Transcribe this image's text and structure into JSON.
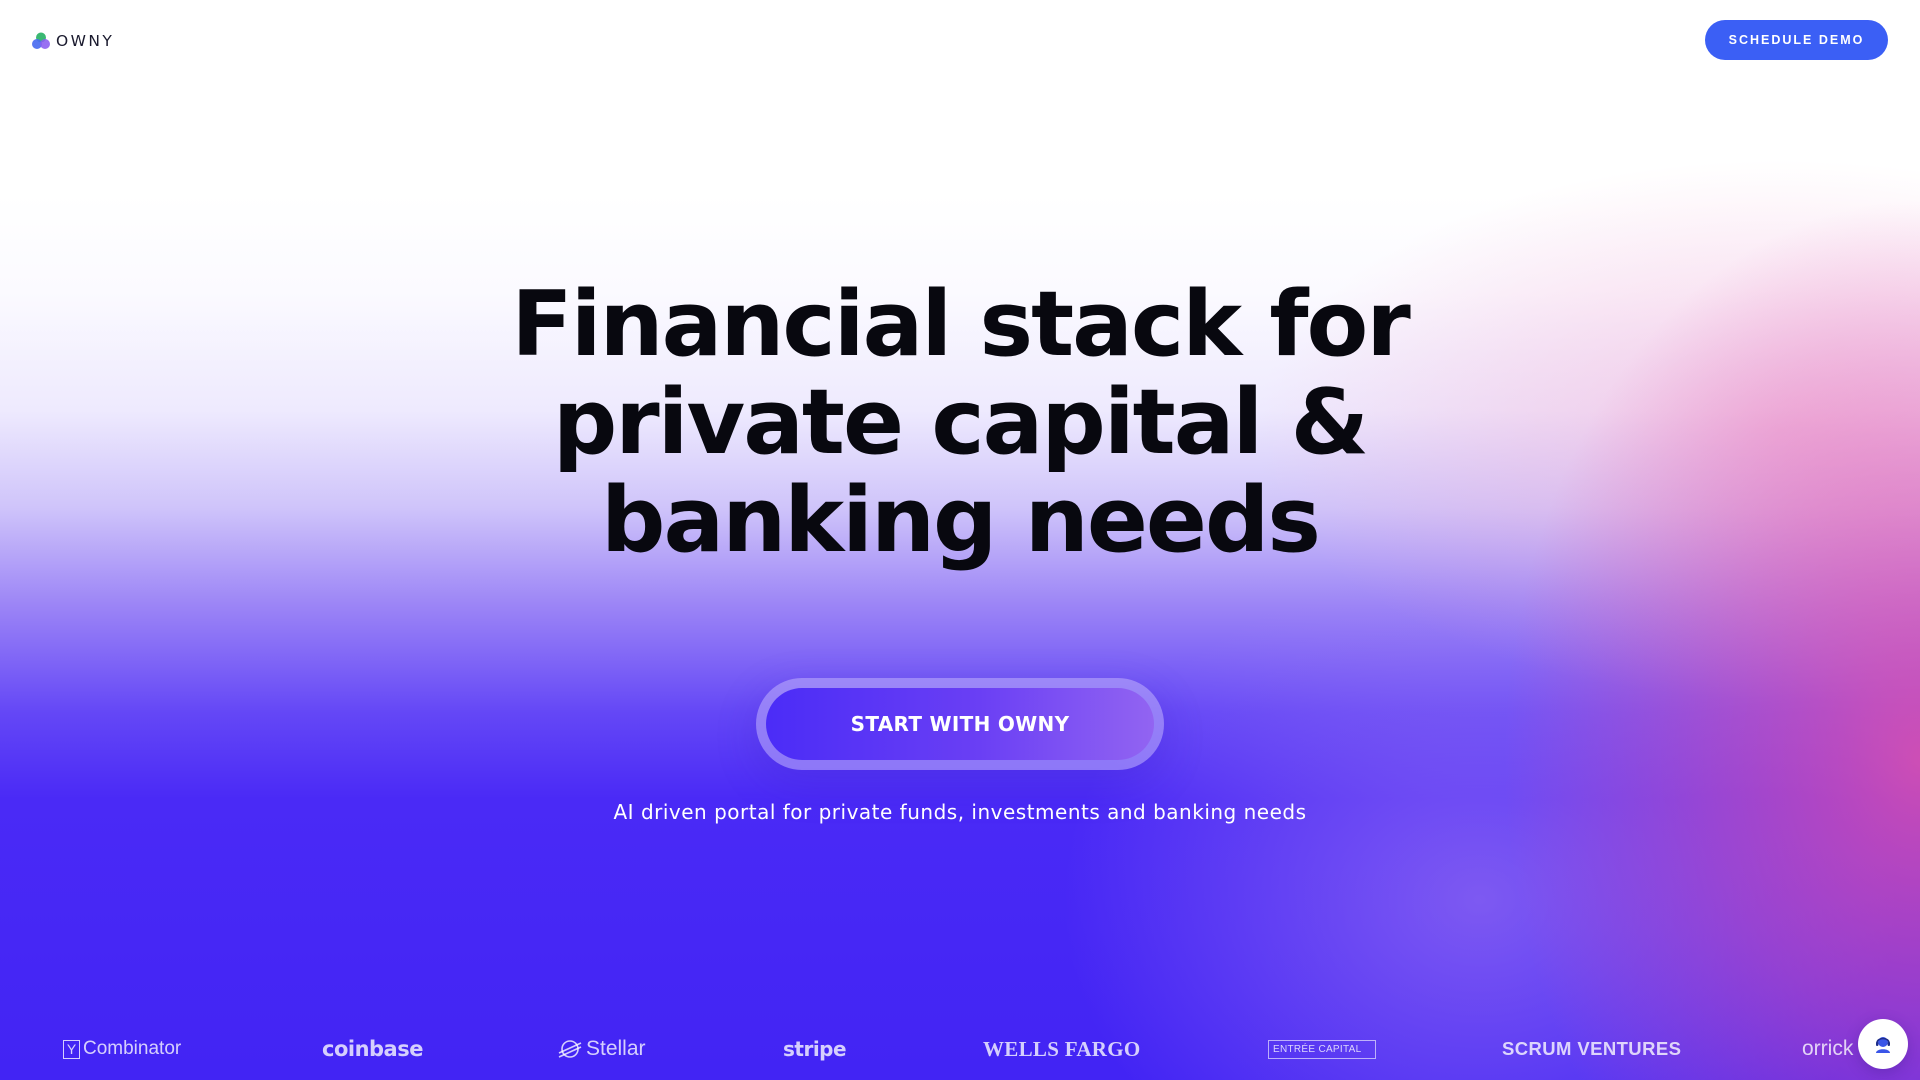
{
  "header": {
    "logo_text": "OWNY",
    "logo_icon": "owny-logo-icon",
    "demo_button": "SCHEDULE DEMO"
  },
  "hero": {
    "headline_lines": [
      "Financial stack for",
      "private capital &",
      "banking needs"
    ],
    "cta_button": "START WITH OWNY",
    "subtitle": "AI driven portal for private funds, investments and banking needs"
  },
  "partners": {
    "yc_box": "Y",
    "yc": "Combinator",
    "coinbase": "coinbase",
    "stellar": "Stellar",
    "stripe": "stripe",
    "wells_fargo": "WELLS FARGO",
    "entree": "ENTRÉE CAPITAL",
    "scrum": "SCRUM VENTURES",
    "orrick": "orrick"
  },
  "chat": {
    "icon": "support-agent-icon"
  },
  "colors": {
    "brand_blue": "#3b5ff5",
    "hero_purple": "#4224f4",
    "pink_accent": "#e252aa",
    "headline": "#08080f"
  }
}
